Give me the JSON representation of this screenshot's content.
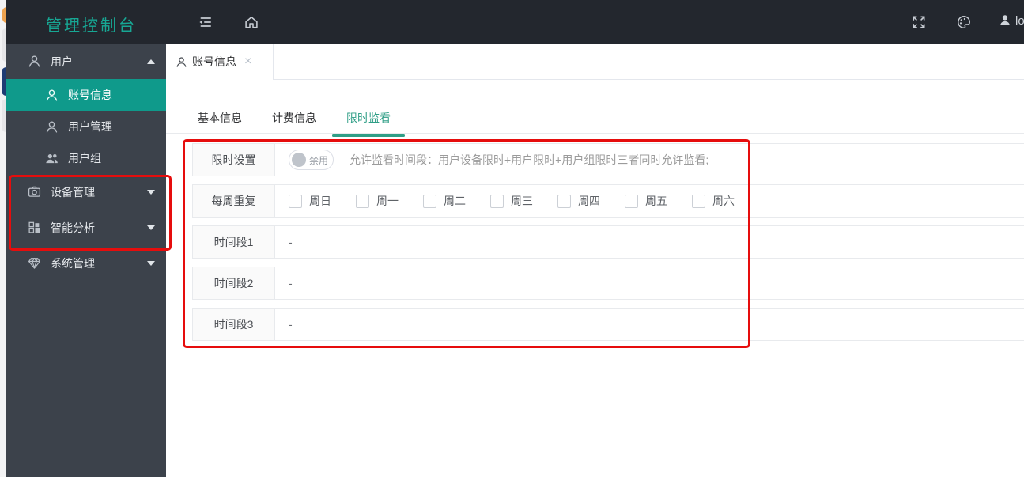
{
  "topbar": {
    "title": "管理控制台",
    "username": "lo",
    "icons": {
      "left": [
        "collapse-menu",
        "home"
      ],
      "right": [
        "fullscreen",
        "theme-palette",
        "user"
      ]
    }
  },
  "sidebar": {
    "items": [
      {
        "label": "用户",
        "icon": "user-outline",
        "state": "expanded"
      },
      {
        "label": "账号信息",
        "icon": "user-outline",
        "state": "active"
      },
      {
        "label": "用户管理",
        "icon": "user-outline",
        "state": "normal"
      },
      {
        "label": "用户组",
        "icon": "user-group",
        "state": "normal"
      },
      {
        "label": "设备管理",
        "icon": "camera",
        "state": "collapsed"
      },
      {
        "label": "智能分析",
        "icon": "blocks",
        "state": "collapsed"
      },
      {
        "label": "系统管理",
        "icon": "gem",
        "state": "collapsed"
      }
    ]
  },
  "tabbar": {
    "tabs": [
      {
        "label": "账号信息",
        "icon": "user-outline",
        "closable": true,
        "active": true
      }
    ]
  },
  "subtabs": {
    "items": [
      "基本信息",
      "计费信息",
      "限时监看"
    ],
    "active": "限时监看"
  },
  "form": {
    "rows": [
      {
        "label": "限时设置",
        "control": "toggle",
        "toggle_label": "禁用",
        "toggle_state": "off",
        "hint": "允许监看时间段：用户设备限时+用户限时+用户组限时三者同时允许监看;"
      },
      {
        "label": "每周重复",
        "control": "checkbox-group",
        "days": [
          "周日",
          "周一",
          "周二",
          "周三",
          "周四",
          "周五",
          "周六"
        ],
        "checked": []
      },
      {
        "label": "时间段1",
        "value": "-"
      },
      {
        "label": "时间段2",
        "value": "-"
      },
      {
        "label": "时间段3",
        "value": "-"
      }
    ]
  },
  "annotations": {
    "color": "#e60d0d",
    "regions": [
      "sidebar-device-and-analysis-items",
      "time-limit-form"
    ]
  },
  "colors": {
    "topbar_bg": "#23272e",
    "sidebar_bg": "#3c424b",
    "accent_teal": "#0f9a8b",
    "title_teal": "#17a794",
    "active_subtab": "#2f9e86",
    "annotation_red": "#e60d0d"
  }
}
